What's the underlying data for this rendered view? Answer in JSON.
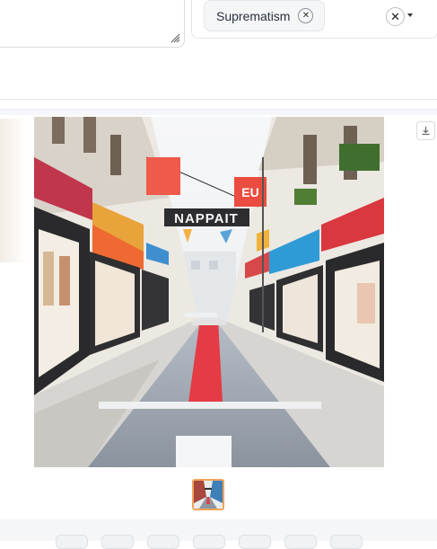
{
  "style_selector": {
    "selected_chips": [
      {
        "label": "Suprematism"
      }
    ]
  },
  "gallery": {
    "image_sign_text": "NAPPAIT",
    "thumbnail_count": 1
  },
  "footer": {
    "buttons": [
      "",
      "",
      "",
      "",
      "",
      "",
      ""
    ]
  }
}
